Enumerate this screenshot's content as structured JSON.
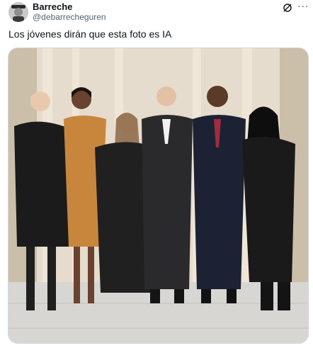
{
  "author": {
    "display_name": "Barreche",
    "handle": "@debarrecheguren",
    "avatar_icon": "avatar-icon"
  },
  "actions": {
    "grok_icon": "grok-icon",
    "more_icon": "more-icon",
    "more_glyph": "···"
  },
  "tweet": {
    "text": "Los jóvenes dirán que esta foto es IA"
  },
  "media": {
    "type": "photo"
  },
  "colors": {
    "text_primary": "#0f1419",
    "text_secondary": "#536471",
    "border": "#cfd9de"
  }
}
